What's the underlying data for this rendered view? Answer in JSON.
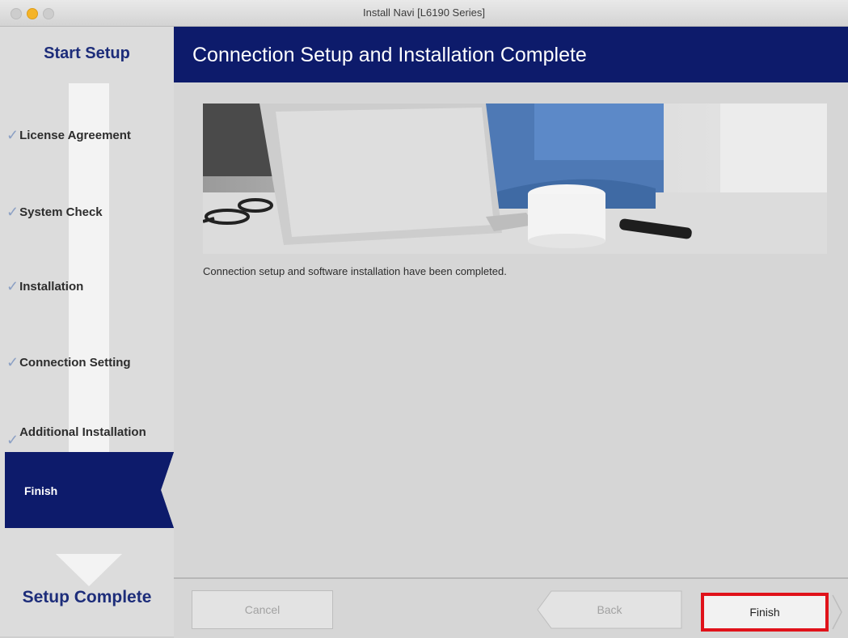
{
  "window": {
    "title": "Install Navi [L6190 Series]"
  },
  "sidebar": {
    "start_label": "Start Setup",
    "complete_label": "Setup Complete",
    "steps": [
      {
        "label": "License Agreement",
        "done": true
      },
      {
        "label": "System Check",
        "done": true
      },
      {
        "label": "Installation",
        "done": true
      },
      {
        "label": "Connection Setting",
        "done": true
      },
      {
        "label": "Additional Installation",
        "done": true
      }
    ],
    "current_step": "Finish",
    "check_glyph": "✓"
  },
  "header": {
    "title": "Connection Setup and Installation Complete"
  },
  "main": {
    "image_icon": "office-photo",
    "message": "Connection setup and software installation have been completed."
  },
  "footer": {
    "cancel_label": "Cancel",
    "back_label": "Back",
    "finish_label": "Finish"
  },
  "colors": {
    "brand_navy": "#0d1b6b",
    "highlight_red": "#e0121a",
    "minimize_yellow": "#f5b428"
  }
}
